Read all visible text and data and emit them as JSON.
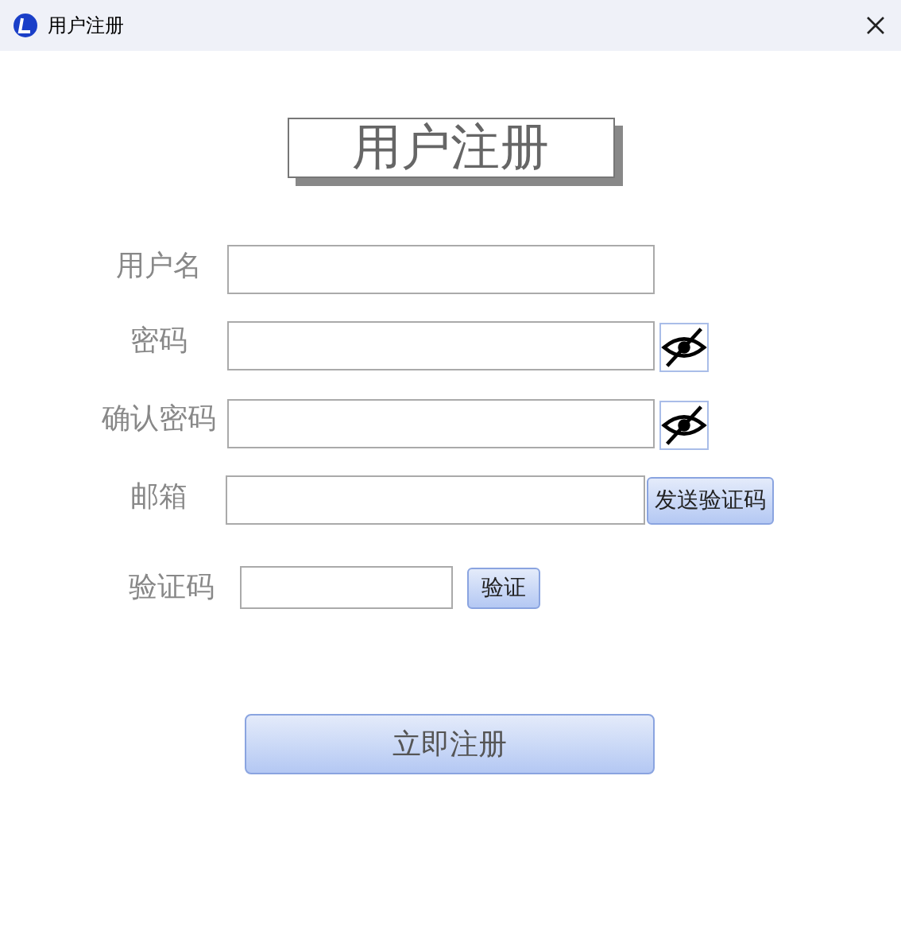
{
  "window": {
    "title": "用户注册"
  },
  "heading": "用户注册",
  "fields": [
    {
      "kind": "plain",
      "label": "用户名"
    },
    {
      "kind": "password",
      "label": "密码",
      "revealed": false
    },
    {
      "kind": "password",
      "label": "确认密码",
      "revealed": false
    },
    {
      "kind": "email",
      "label": "邮箱",
      "button": "发送验证码"
    }
  ],
  "captcha": {
    "label": "验证码",
    "button": "验证"
  },
  "submit": "立即注册"
}
